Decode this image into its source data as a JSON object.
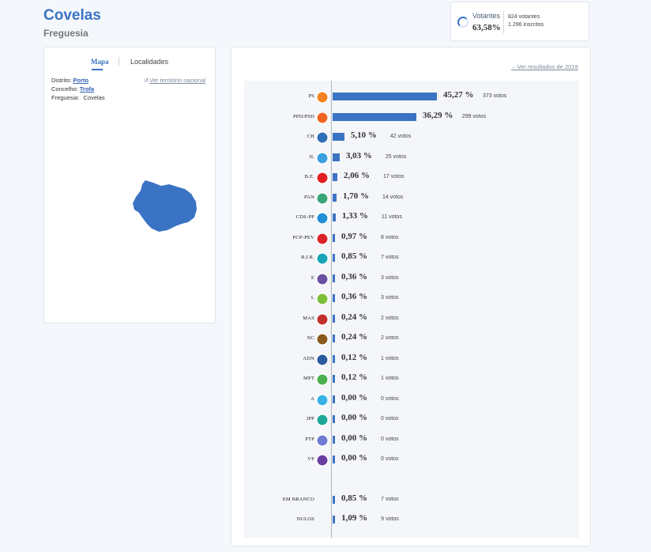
{
  "header": {
    "title": "Covelas",
    "subtitle": "Freguesia"
  },
  "turnout": {
    "label": "Votantes",
    "percent": "63,58%",
    "voters": "824 votantes",
    "registered": "1.296 inscritos"
  },
  "left_panel": {
    "tabs": [
      "Mapa",
      "Localidades"
    ],
    "district_label": "Distrito:",
    "district_value": "Porto",
    "municipality_label": "Concelho:",
    "municipality_value": "Trofa",
    "parish_label": "Freguesia:",
    "parish_value": "Covelas",
    "national_link": "Ver território nacional"
  },
  "results": {
    "back_link": "Ver resultados de 2019",
    "accent_color": "#3a73c4",
    "rows": [
      {
        "party": "PS",
        "pct": "45,27 %",
        "votes": "373 votos",
        "share": 45.27
      },
      {
        "party": "PPD/PSD",
        "pct": "36,29 %",
        "votes": "299 votos",
        "share": 36.29
      },
      {
        "party": "CH",
        "pct": "5,10 %",
        "votes": "42 votos",
        "share": 5.1
      },
      {
        "party": "IL",
        "pct": "3,03 %",
        "votes": "25 votos",
        "share": 3.03
      },
      {
        "party": "B.E.",
        "pct": "2,06 %",
        "votes": "17 votos",
        "share": 2.06
      },
      {
        "party": "PAN",
        "pct": "1,70 %",
        "votes": "14 votos",
        "share": 1.7
      },
      {
        "party": "CDS-PP",
        "pct": "1,33 %",
        "votes": "11 votos",
        "share": 1.33
      },
      {
        "party": "PCP-PEV",
        "pct": "0,97 %",
        "votes": "8 votos",
        "share": 0.97
      },
      {
        "party": "R.I.R.",
        "pct": "0,85 %",
        "votes": "7 votos",
        "share": 0.85
      },
      {
        "party": "E",
        "pct": "0,36 %",
        "votes": "3 votos",
        "share": 0.36
      },
      {
        "party": "L",
        "pct": "0,36 %",
        "votes": "3 votos",
        "share": 0.36
      },
      {
        "party": "MAS",
        "pct": "0,24 %",
        "votes": "2 votos",
        "share": 0.24
      },
      {
        "party": "NC",
        "pct": "0,24 %",
        "votes": "2 votos",
        "share": 0.24
      },
      {
        "party": "ADN",
        "pct": "0,12 %",
        "votes": "1 votos",
        "share": 0.12
      },
      {
        "party": "MPT",
        "pct": "0,12 %",
        "votes": "1 votos",
        "share": 0.12
      },
      {
        "party": "A",
        "pct": "0,00 %",
        "votes": "0 votos",
        "share": 0
      },
      {
        "party": "JPP",
        "pct": "0,00 %",
        "votes": "0 votos",
        "share": 0
      },
      {
        "party": "PTP",
        "pct": "0,00 %",
        "votes": "0 votos",
        "share": 0
      },
      {
        "party": "VP",
        "pct": "0,00 %",
        "votes": "0 votos",
        "share": 0
      }
    ],
    "special_rows": [
      {
        "party": "EM BRANCO",
        "pct": "0,85 %",
        "votes": "7 votos",
        "share": 0.85
      },
      {
        "party": "NULOS",
        "pct": "1,09 %",
        "votes": "9 votos",
        "share": 1.09
      }
    ]
  }
}
